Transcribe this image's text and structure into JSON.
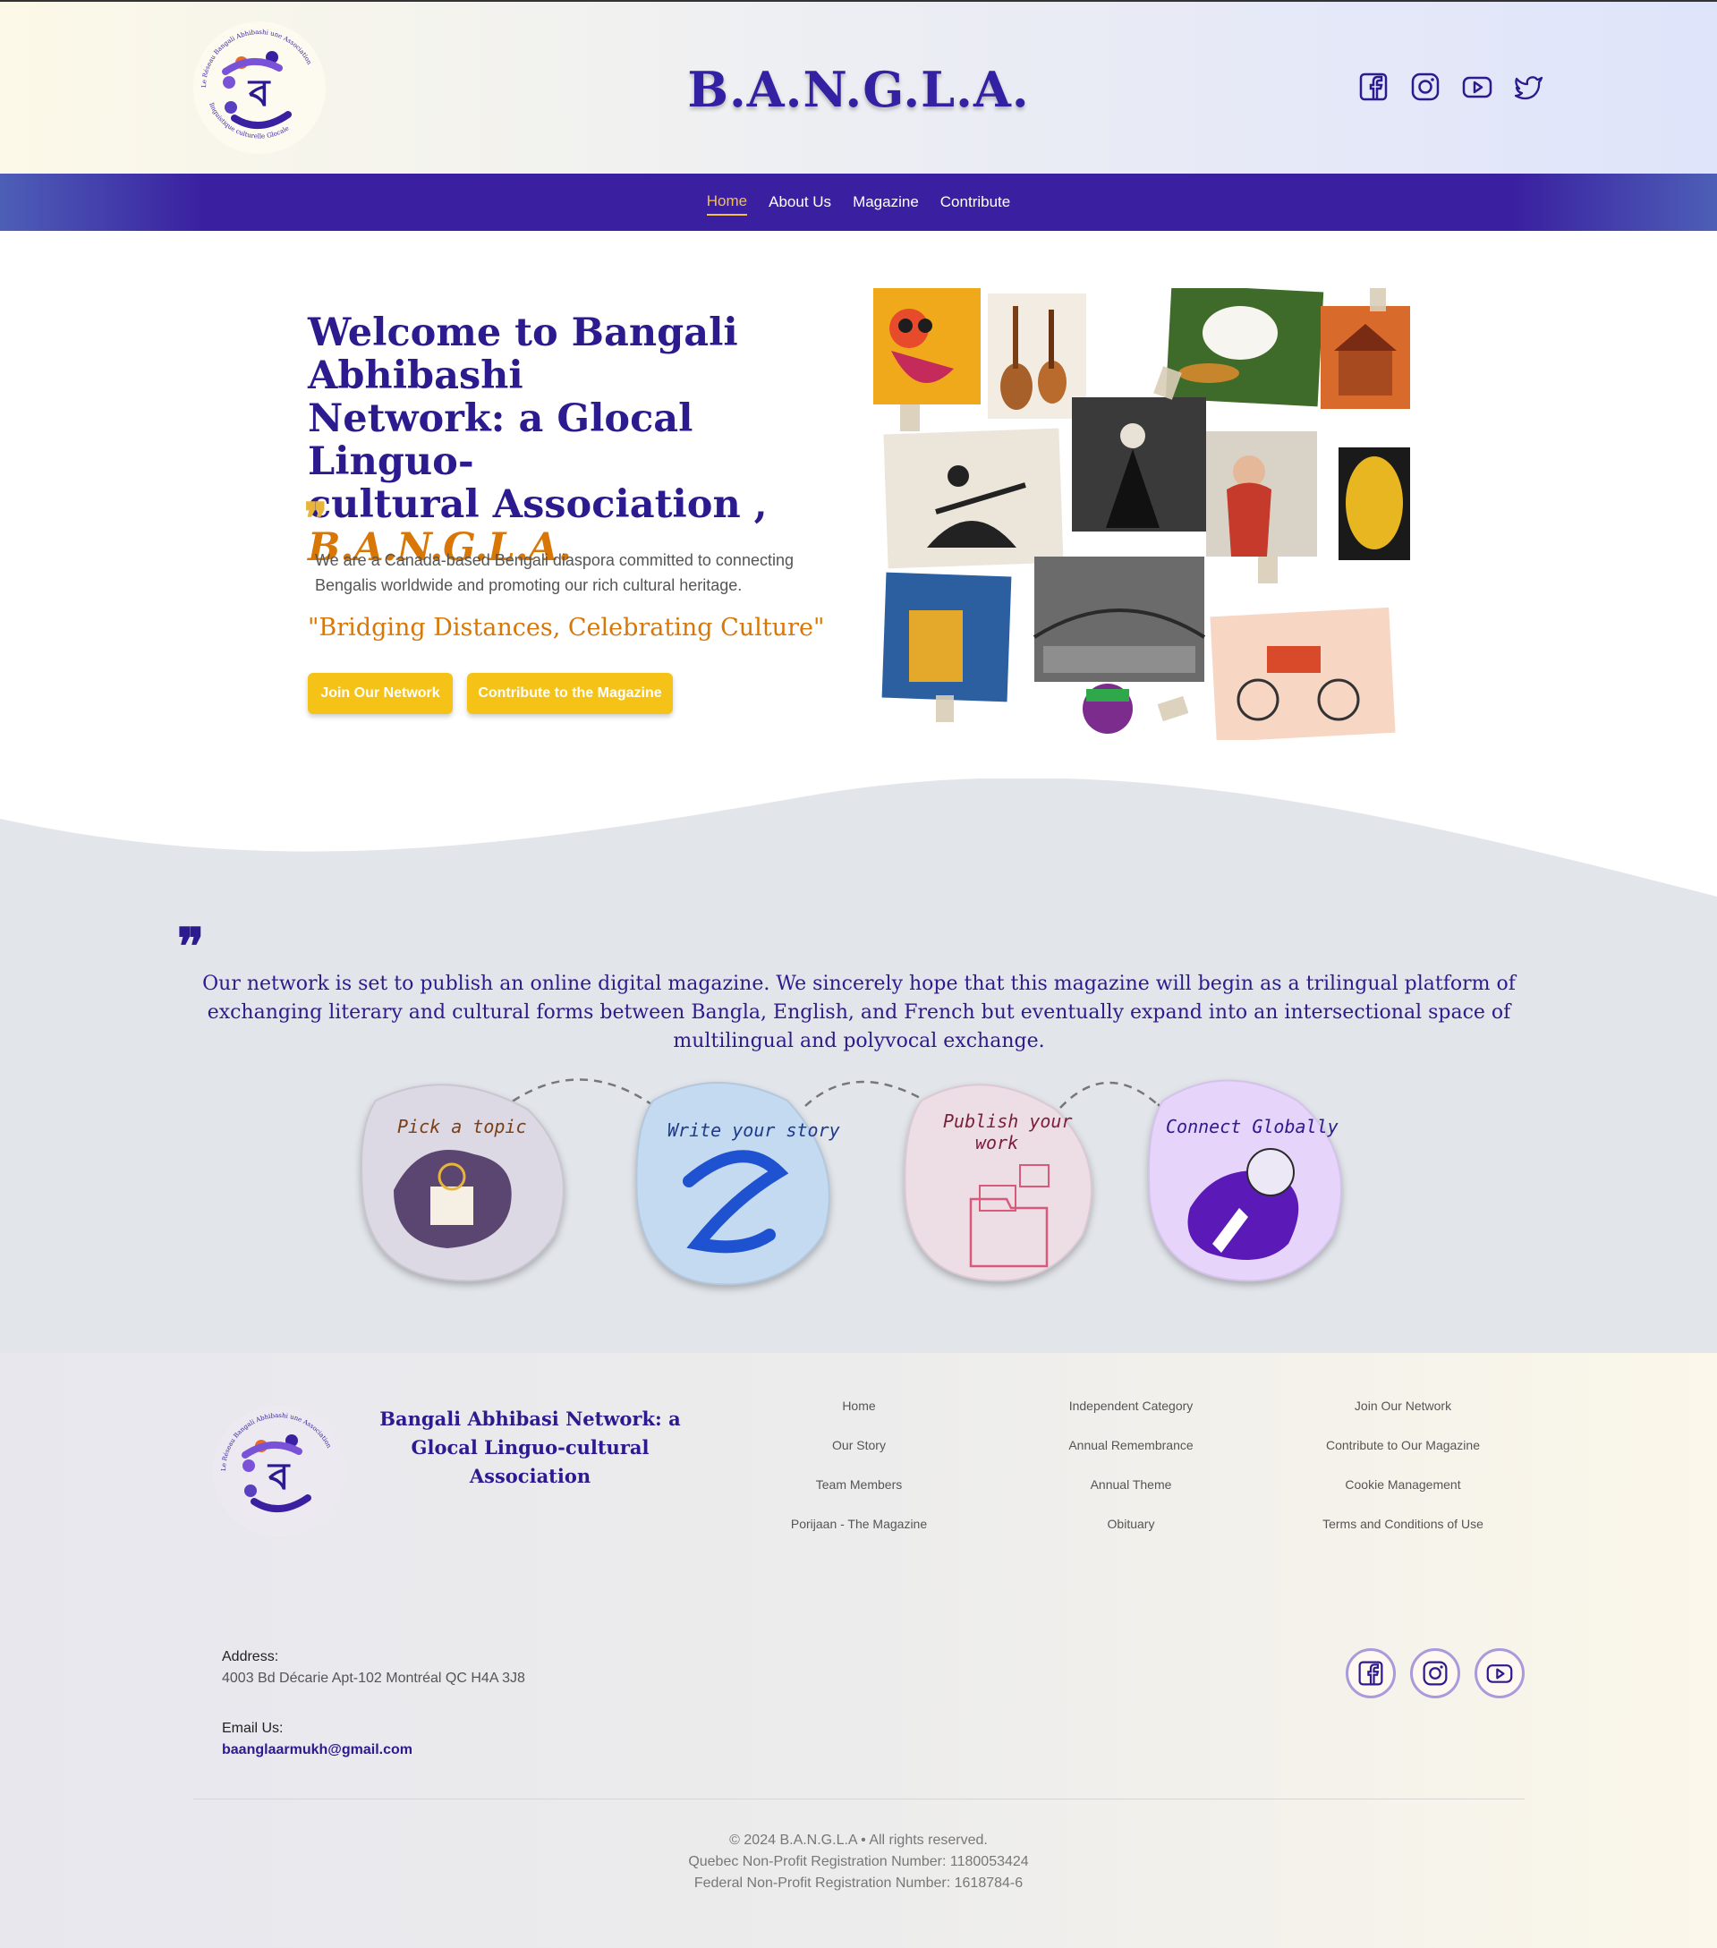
{
  "header": {
    "site_title": "B.A.N.G.L.A.",
    "logo_ring_text": "Le Réseau Bangali Abhibashi une Association linguistique culturelle Glocale",
    "logo_letter": "ব",
    "socials": [
      "facebook-icon",
      "instagram-icon",
      "youtube-icon",
      "twitter-icon"
    ]
  },
  "nav": {
    "items": [
      "Home",
      "About Us",
      "Magazine",
      "Contribute"
    ],
    "active": "Home"
  },
  "hero": {
    "title_line1": "Welcome to Bangali Abhibashi",
    "title_line2": "Network: a Glocal Linguo-",
    "title_line3": "cultural Association ,",
    "title_accent": "B.A.N.G.L.A.",
    "quote_mark": "❞",
    "description": "We are a Canada-based Bengali diaspora committed to connecting Bengalis worldwide and promoting our rich cultural heritage.",
    "tagline": "\"Bridging Distances, Celebrating Culture\"",
    "btn_join": "Join Our Network",
    "btn_contribute": "Contribute to the Magazine"
  },
  "magazine": {
    "quote_mark": "❞",
    "text": "Our network is set to publish an online digital magazine. We sincerely hope that this magazine will begin as a trilingual platform of exchanging literary and cultural forms between Bangla, English, and French but eventually expand into an intersectional space of multilingual and polyvocal exchange.",
    "steps": [
      "Pick a topic",
      "Write your story",
      "Publish your work",
      "Connect Globally"
    ],
    "step_publish_line1": "Publish your",
    "step_publish_line2": "work"
  },
  "footer": {
    "org_name": "Bangali Abhibasi Network: a Glocal Linguo-cultural Association",
    "col1": [
      "Home",
      "Our Story",
      "Team Members",
      "Porijaan - The Magazine"
    ],
    "col2": [
      "Independent Category",
      "Annual Remembrance",
      "Annual Theme",
      "Obituary"
    ],
    "col3": [
      "Join Our Network",
      "Contribute to Our Magazine",
      "Cookie Management",
      "Terms and Conditions of Use"
    ],
    "address_label": "Address:",
    "address": "4003 Bd Décarie Apt-102 Montréal QC H4A 3J8",
    "email_label": "Email Us:",
    "email": "baanglaarmukh@gmail.com",
    "copyright": "© 2024 B.A.N.G.L.A • All rights reserved.",
    "quebec_reg": "Quebec Non-Profit Registration Number: 1180053424",
    "federal_reg": "Federal Non-Profit Registration Number: 1618784-6"
  },
  "colors": {
    "brand": "#3a1fa0",
    "accent": "#d97706",
    "button": "#f5c318",
    "section_bg": "#e2e6eb"
  }
}
